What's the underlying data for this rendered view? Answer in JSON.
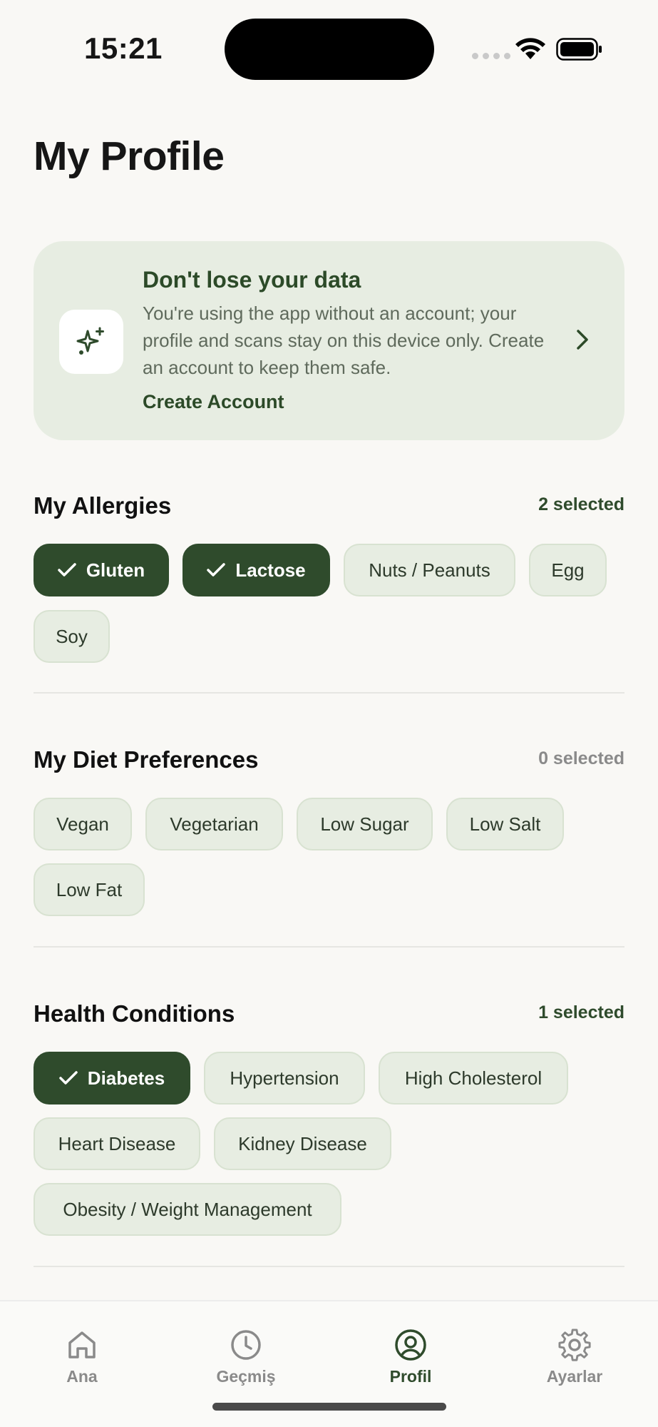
{
  "status": {
    "time": "15:21"
  },
  "page": {
    "title": "My Profile"
  },
  "banner": {
    "title": "Don't lose your data",
    "text": "You're using the app without an account; your profile and scans stay on this device only. Create an account to keep them safe.",
    "link": "Create Account",
    "icon": "sparkles-icon"
  },
  "allergies": {
    "title": "My Allergies",
    "count": "2 selected",
    "chips": [
      {
        "label": "Gluten",
        "selected": true
      },
      {
        "label": "Lactose",
        "selected": true
      },
      {
        "label": "Nuts / Peanuts",
        "selected": false
      },
      {
        "label": "Egg",
        "selected": false
      },
      {
        "label": "Soy",
        "selected": false
      }
    ]
  },
  "diet": {
    "title": "My Diet Preferences",
    "count": "0 selected",
    "chips": [
      {
        "label": "Vegan",
        "selected": false
      },
      {
        "label": "Vegetarian",
        "selected": false
      },
      {
        "label": "Low Sugar",
        "selected": false
      },
      {
        "label": "Low Salt",
        "selected": false
      },
      {
        "label": "Low Fat",
        "selected": false
      }
    ]
  },
  "health": {
    "title": "Health Conditions",
    "count": "1 selected",
    "chips": [
      {
        "label": "Diabetes",
        "selected": true
      },
      {
        "label": "Hypertension",
        "selected": false
      },
      {
        "label": "High Cholesterol",
        "selected": false
      },
      {
        "label": "Heart Disease",
        "selected": false
      },
      {
        "label": "Kidney Disease",
        "selected": false
      },
      {
        "label": "Obesity / Weight Management",
        "selected": false
      }
    ]
  },
  "tabs": [
    {
      "label": "Ana",
      "icon": "home-icon",
      "active": false
    },
    {
      "label": "Geçmiş",
      "icon": "clock-icon",
      "active": false
    },
    {
      "label": "Profil",
      "icon": "profile-icon",
      "active": true
    },
    {
      "label": "Ayarlar",
      "icon": "gear-icon",
      "active": false
    }
  ],
  "colors": {
    "accent": "#2f4b2c",
    "chip_bg": "#e7ede2",
    "background": "#f9f8f5"
  }
}
